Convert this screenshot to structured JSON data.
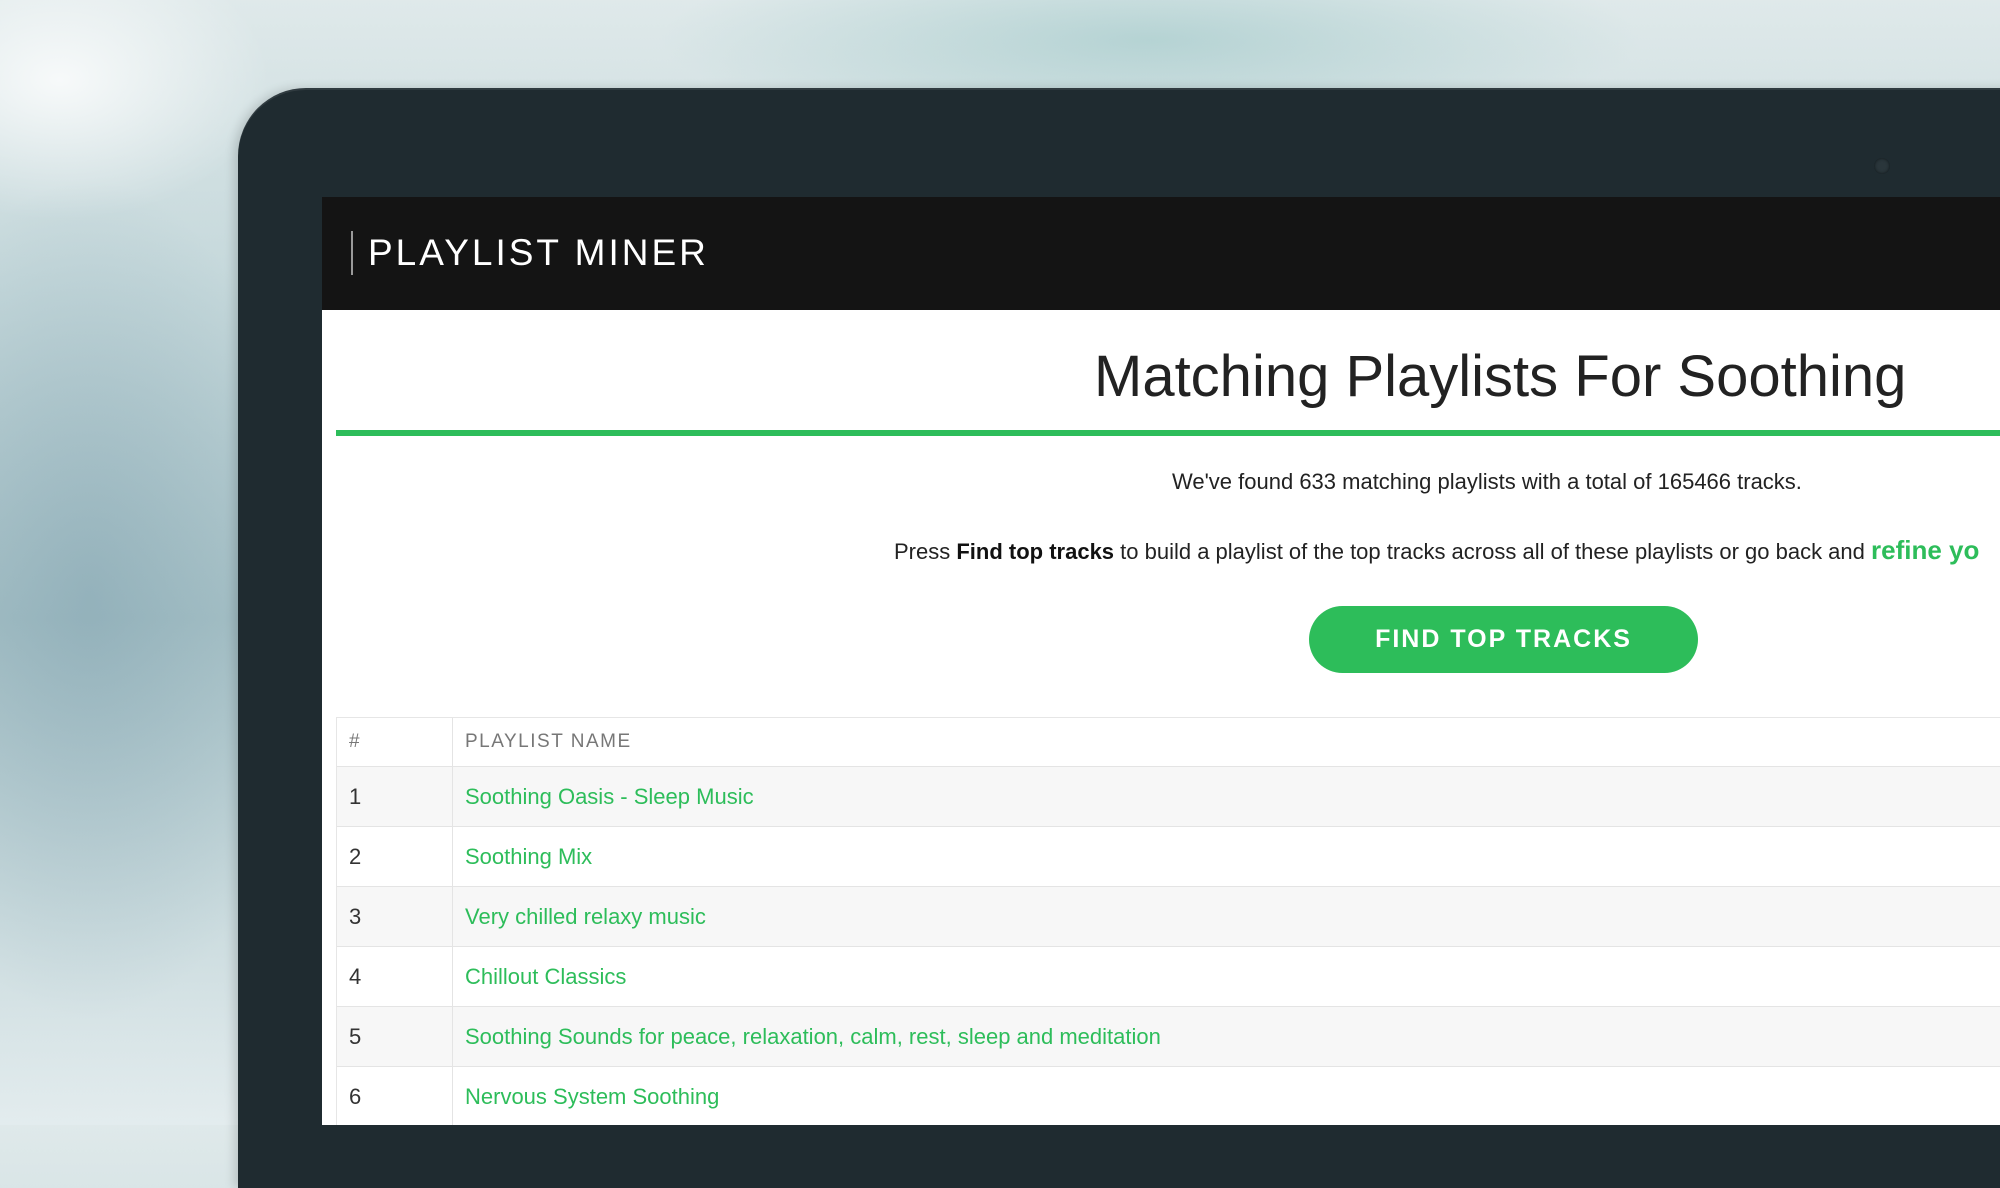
{
  "app": {
    "logo": "PLAYLIST MINER"
  },
  "page": {
    "title": "Matching Playlists For Soothing",
    "found_text": "We've found 633 matching playlists with a total of 165466 tracks.",
    "press_prefix": "Press ",
    "press_bold": "Find top tracks",
    "press_middle": " to build a playlist of the top tracks across all of these playlists or go back and ",
    "refine_link": "refine yo",
    "find_button": "FIND TOP TRACKS"
  },
  "table": {
    "headers": {
      "num": "#",
      "name": "PLAYLIST NAME"
    },
    "rows": [
      {
        "num": "1",
        "name": "Soothing Oasis - Sleep Music"
      },
      {
        "num": "2",
        "name": "Soothing Mix"
      },
      {
        "num": "3",
        "name": "Very chilled relaxy music"
      },
      {
        "num": "4",
        "name": "Chillout Classics"
      },
      {
        "num": "5",
        "name": "Soothing Sounds for peace, relaxation, calm, rest, sleep and meditation"
      },
      {
        "num": "6",
        "name": "Nervous System Soothing"
      }
    ]
  },
  "colors": {
    "accent": "#2dbd5a",
    "header_bg": "#141414",
    "bezel": "#1f2b30"
  }
}
